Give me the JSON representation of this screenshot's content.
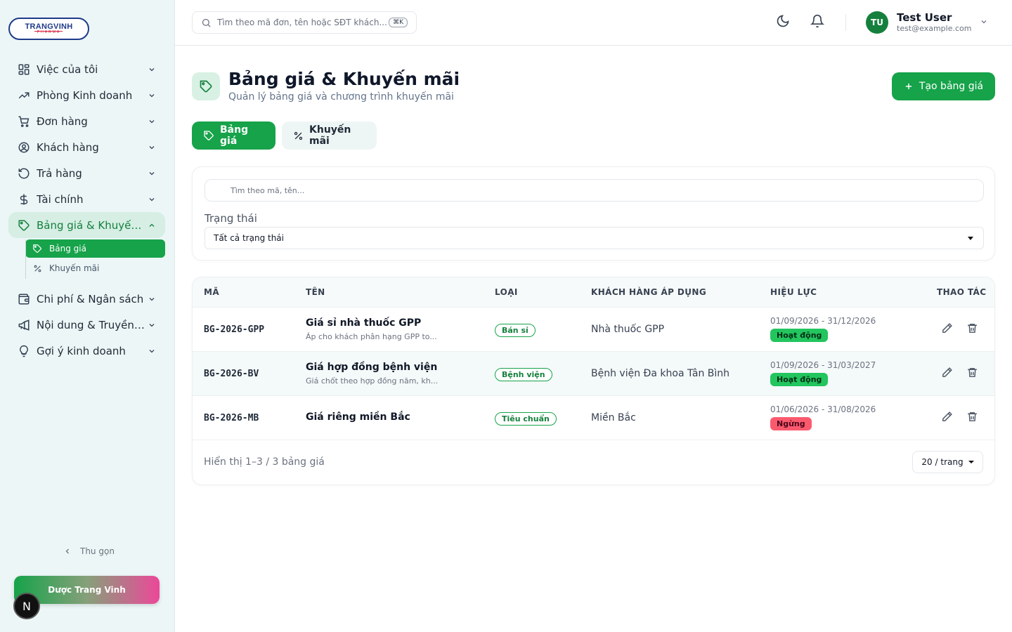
{
  "brand": {
    "logo_text": "TRANGVINH",
    "logo_sub": "PHARMA",
    "footer_button": "Dược Trang Vinh",
    "badge": "N"
  },
  "sidebar": {
    "items": [
      {
        "label": "Việc của tôi",
        "icon": "grid-icon"
      },
      {
        "label": "Phòng Kinh doanh",
        "icon": "trending-up-icon"
      },
      {
        "label": "Đơn hàng",
        "icon": "cart-icon"
      },
      {
        "label": "Khách hàng",
        "icon": "user-circle-icon"
      },
      {
        "label": "Trả hàng",
        "icon": "rotate-ccw-icon"
      },
      {
        "label": "Tài chính",
        "icon": "dollar-icon"
      },
      {
        "label": "Bảng giá & Khuyến mãi",
        "icon": "tag-icon",
        "active": true
      },
      {
        "label": "Chi phí & Ngân sách",
        "icon": "wallet-icon"
      },
      {
        "label": "Nội dung & Truyền thông",
        "icon": "megaphone-icon"
      },
      {
        "label": "Gợi ý kinh doanh",
        "icon": "lightbulb-icon"
      }
    ],
    "sub_items": [
      {
        "label": "Bảng giá",
        "icon": "tag-icon",
        "active": true
      },
      {
        "label": "Khuyến mãi",
        "icon": "percent-icon"
      }
    ],
    "collapse_label": "Thu gọn"
  },
  "header": {
    "search_placeholder": "Tìm theo mã đơn, tên hoặc SĐT khách...",
    "shortcut": "⌘K",
    "user_initials": "TU",
    "user_name": "Test User",
    "user_email": "test@example.com"
  },
  "page": {
    "title": "Bảng giá & Khuyến mãi",
    "subtitle": "Quản lý bảng giá và chương trình khuyến mãi",
    "create_button": "Tạo bảng giá",
    "tabs": [
      {
        "label": "Bảng giá",
        "active": true
      },
      {
        "label": "Khuyến mãi"
      }
    ]
  },
  "filters": {
    "search_placeholder": "Tìm theo mã, tên...",
    "status_label": "Trạng thái",
    "status_value": "Tất cả trạng thái"
  },
  "table": {
    "headers": [
      "MÃ",
      "TÊN",
      "LOẠI",
      "KHÁCH HÀNG ÁP DỤNG",
      "HIỆU LỰC",
      "THAO TÁC"
    ],
    "rows": [
      {
        "code": "BG-2026-GPP",
        "name": "Giá sỉ nhà thuốc GPP",
        "desc": "Áp cho khách phân hạng GPP to...",
        "type": "Bán sỉ",
        "customer": "Nhà thuốc GPP",
        "period": "01/09/2026 - 31/12/2026",
        "status": "Hoạt động"
      },
      {
        "code": "BG-2026-BV",
        "name": "Giá hợp đồng bệnh viện",
        "desc": "Giá chốt theo hợp đồng năm, kh...",
        "type": "Bệnh viện",
        "customer": "Bệnh viện Đa khoa Tân Bình",
        "period": "01/09/2026 - 31/03/2027",
        "status": "Hoạt động"
      },
      {
        "code": "BG-2026-MB",
        "name": "Giá riêng miền Bắc",
        "desc": "",
        "type": "Tiêu chuẩn",
        "customer": "Miền Bắc",
        "period": "01/06/2026 - 31/08/2026",
        "status": "Ngừng"
      }
    ],
    "footer_text": "Hiển thị 1–3 / 3 bảng giá",
    "page_size": "20 / trang"
  },
  "colors": {
    "primary": "#16a34a",
    "sidebar_bg": "#ecf6f6",
    "active_status": "#22c55e",
    "stopped_status": "#fb5a6e"
  }
}
